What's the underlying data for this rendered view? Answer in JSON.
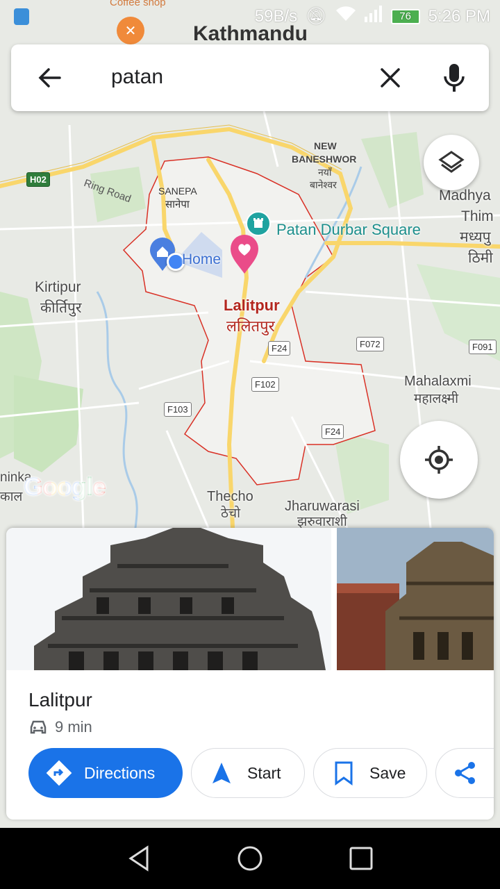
{
  "status_bar": {
    "net_speed": "59B/s",
    "battery": "76",
    "time": "5:26 PM"
  },
  "search": {
    "query": "patan"
  },
  "map": {
    "labels": {
      "coffee_shop": "Coffee shop",
      "kathmandu": "Kathmandu",
      "new_baneshwor_1": "NEW",
      "new_baneshwor_2": "BANESHWOR",
      "new_baneshwor_np1": "नयाँ",
      "new_baneshwor_np2": "बानेश्वर",
      "ring_road": "Ring Road",
      "sanepa": "SANEPA",
      "sanepa_np": "सानेपा",
      "madhya_1": "Madhya",
      "madhya_2": "Thim",
      "madhya_np1": "मध्यपु",
      "madhya_np2": "ठिमी",
      "patan_durbar_square": "Patan Durbar Square",
      "home": "Home",
      "kirtipur": "Kirtipur",
      "kirtipur_np": "कीर्तिपुर",
      "lalitpur": "Lalitpur",
      "lalitpur_np": "ललितपुर",
      "mahalaxmi": "Mahalaxmi",
      "mahalaxmi_np": "महालक्ष्मी",
      "thecho": "Thecho",
      "thecho_np": "ठेचो",
      "jharuwarasi": "Jharuwarasi",
      "jharuwarasi_np": "झरुवाराशी",
      "left_edge_1": "ninka",
      "left_edge_2": "काल"
    },
    "shields": {
      "h02": "H02",
      "f24a": "F24",
      "f072": "F072",
      "f091": "F091",
      "f102": "F102",
      "f103": "F103",
      "f24b": "F24"
    },
    "logo": "Google"
  },
  "place_card": {
    "title": "Lalitpur",
    "drive_time": "9 min",
    "buttons": {
      "directions": "Directions",
      "start": "Start",
      "save": "Save"
    }
  },
  "colors": {
    "accent": "#1a73e8",
    "boundary": "#d93025",
    "road_major": "#f9d66b",
    "poi_teal": "#1fa3a0",
    "pin_pink": "#ea4c89"
  }
}
